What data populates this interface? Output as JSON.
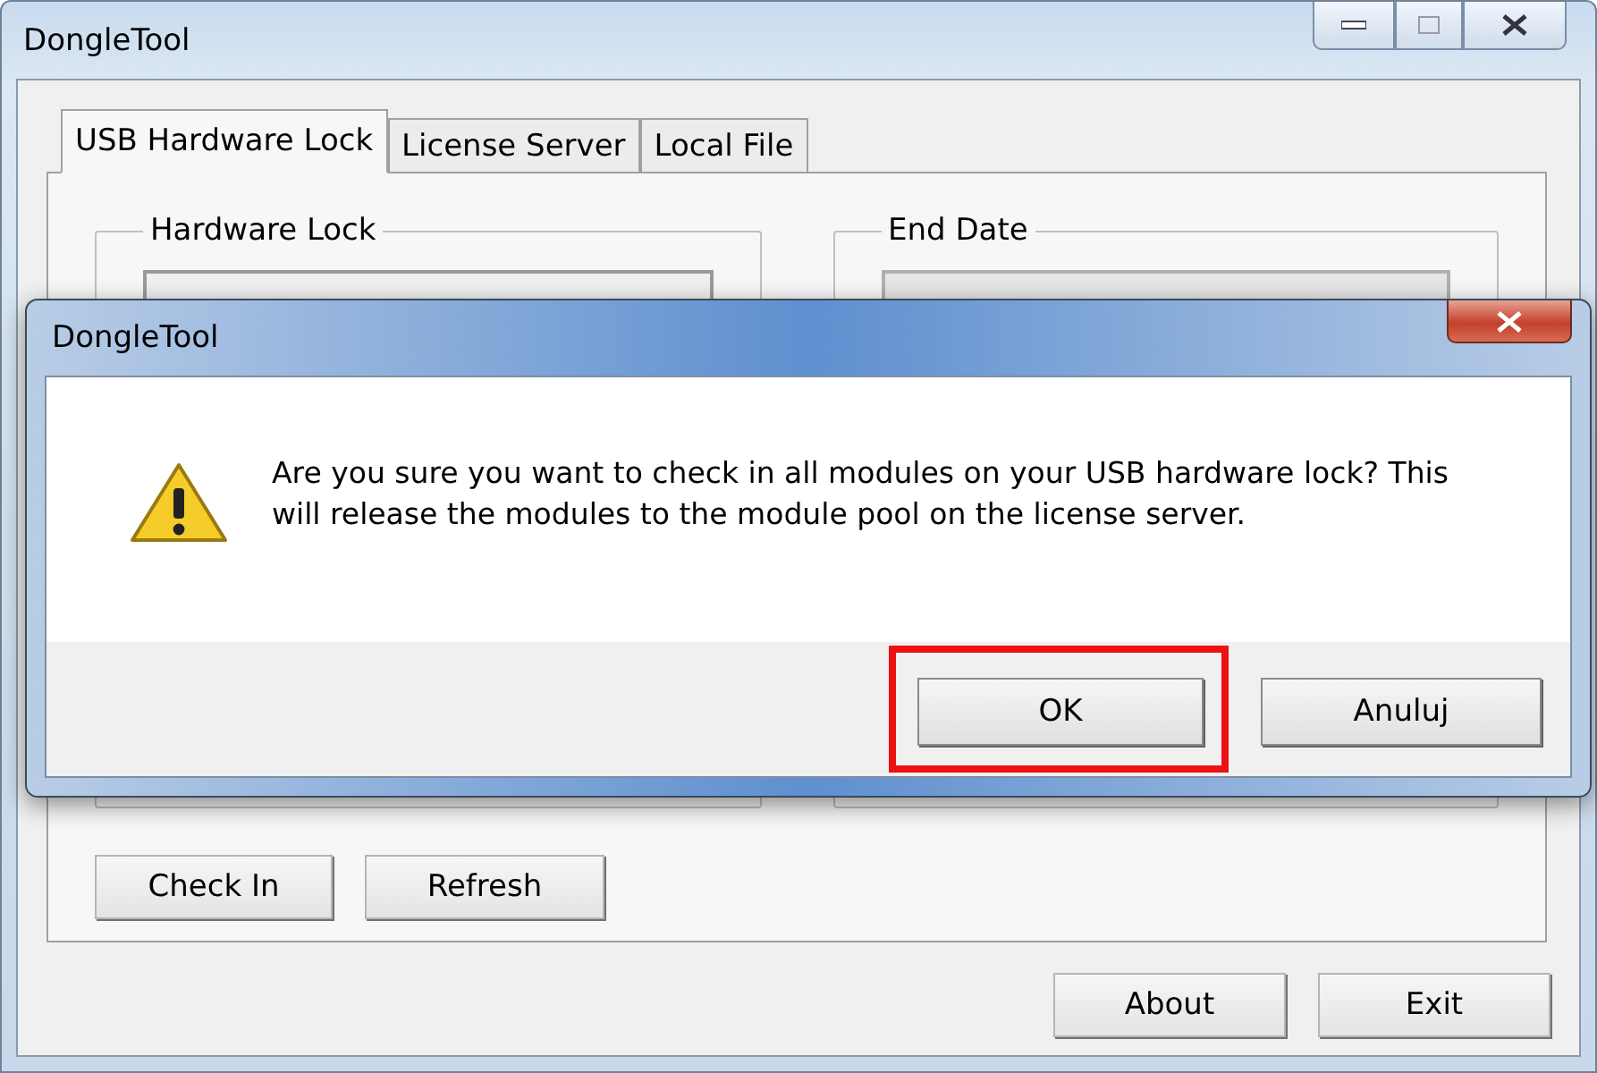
{
  "window": {
    "title": "DongleTool"
  },
  "tabs": [
    {
      "label": "USB Hardware Lock",
      "selected": true
    },
    {
      "label": "License Server",
      "selected": false
    },
    {
      "label": "Local File",
      "selected": false
    }
  ],
  "groups": [
    {
      "label": "Hardware Lock",
      "disabled": false
    },
    {
      "label": "End Date",
      "disabled": true
    }
  ],
  "actions": [
    "Check In",
    "Refresh"
  ],
  "footer_buttons": [
    "About",
    "Exit"
  ],
  "dialog": {
    "title": "DongleTool",
    "message": "Are you sure you want to check in all modules on your USB hardware lock? This will release the modules to the module pool on the license server.",
    "buttons": [
      {
        "label": "OK",
        "highlighted": true
      },
      {
        "label": "Anuluj",
        "highlighted": false
      }
    ]
  }
}
